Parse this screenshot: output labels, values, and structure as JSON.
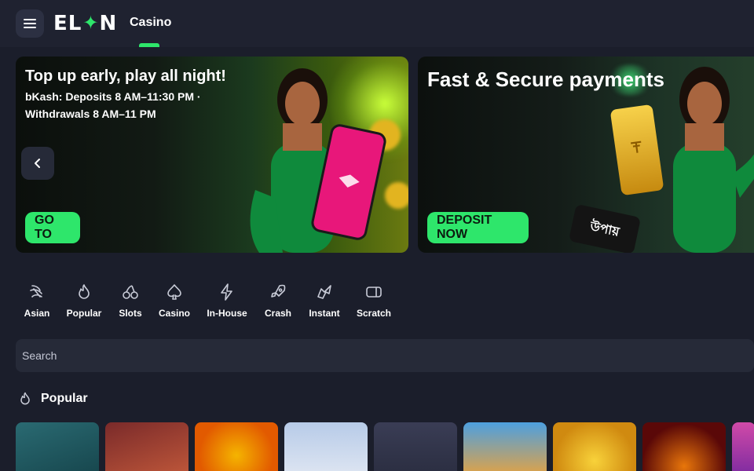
{
  "header": {
    "logo_text_left": "EL",
    "logo_text_right": "N",
    "nav_item": "Casino"
  },
  "banners": [
    {
      "title": "Top up early, play all night!",
      "subtitle_line1": "bKash: Deposits 8 AM–11:30 PM ·",
      "subtitle_line2": "Withdrawals 8 AM–11 PM",
      "cta": "GO TO"
    },
    {
      "title": "Fast & Secure payments",
      "cta": "DEPOSIT NOW",
      "badge_text": "উপায়"
    }
  ],
  "categories": [
    "Asian",
    "Popular",
    "Slots",
    "Casino",
    "In-House",
    "Crash",
    "Instant",
    "Scratch"
  ],
  "search": {
    "placeholder": "Search"
  },
  "section": {
    "title": "Popular"
  },
  "colors": {
    "accent": "#2ee66b",
    "background": "#1b1e2b",
    "surface": "#262a38"
  }
}
